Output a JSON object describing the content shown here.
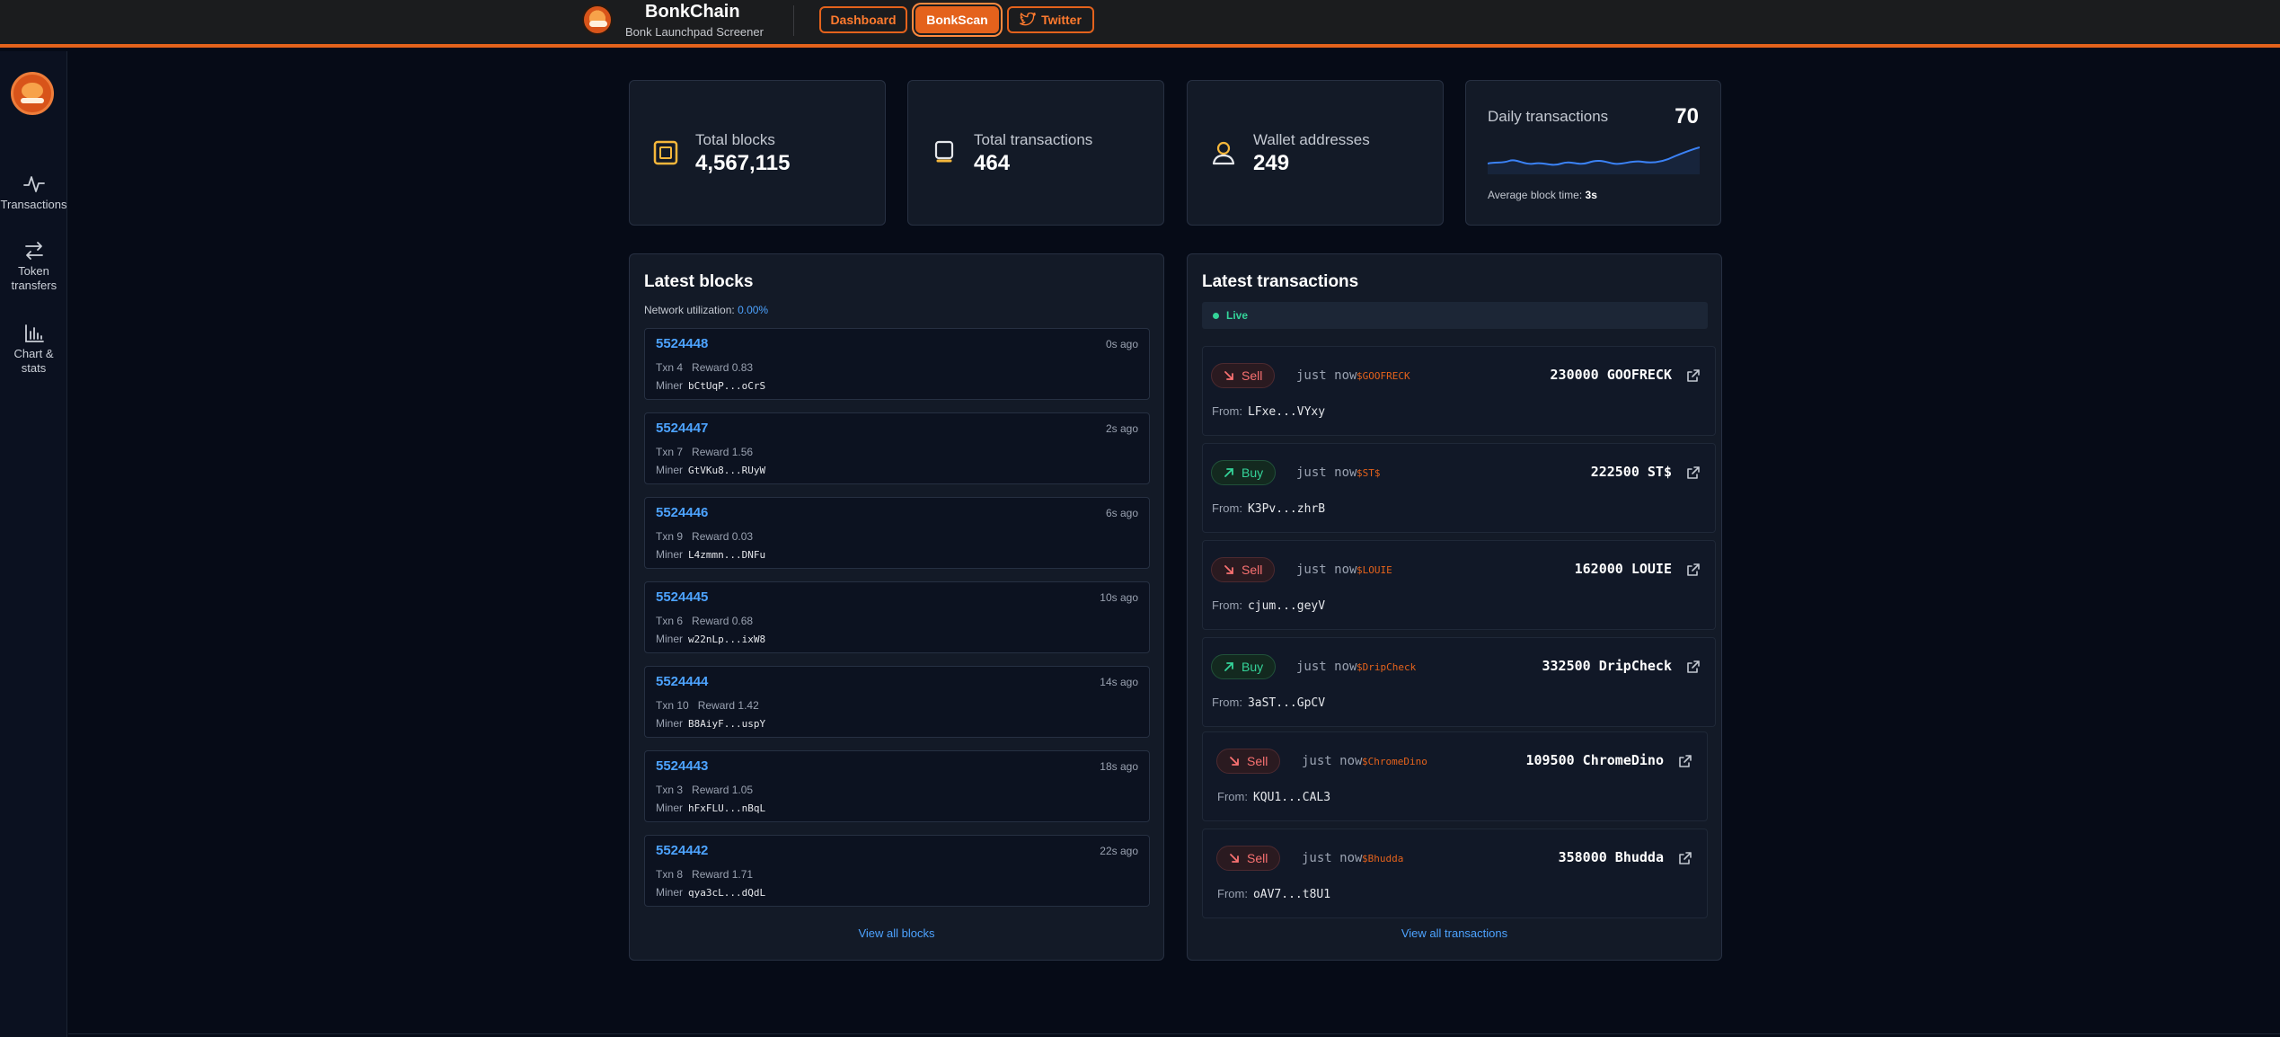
{
  "header": {
    "title": "BonkChain",
    "subtitle": "Bonk Launchpad Screener",
    "nav": {
      "dashboard": "Dashboard",
      "bonkscan": "BonkScan",
      "twitter": "Twitter"
    }
  },
  "sidebar": {
    "items": [
      {
        "label": "Transactions",
        "icon": "activity-icon"
      },
      {
        "label": "Token transfers",
        "icon": "arrows-swap-icon"
      },
      {
        "label": "Chart & stats",
        "icon": "bar-chart-icon"
      }
    ]
  },
  "stats": {
    "total_blocks": {
      "label": "Total blocks",
      "value": "4,567,115"
    },
    "total_transactions": {
      "label": "Total transactions",
      "value": "464"
    },
    "wallet_addresses": {
      "label": "Wallet addresses",
      "value": "249"
    },
    "daily": {
      "label": "Daily transactions",
      "value": "70",
      "avg_label": "Average block time:",
      "avg_value": "3s"
    }
  },
  "blocks_panel": {
    "title": "Latest blocks",
    "util_label": "Network utilization:",
    "util_value": "0.00%",
    "txn_label": "Txn",
    "reward_label": "Reward",
    "miner_label": "Miner",
    "view_all": "View all blocks",
    "blocks": [
      {
        "number": "5524448",
        "ago": "0s ago",
        "txn": "4",
        "reward": "0.83",
        "miner": "bCtUqP...oCrS"
      },
      {
        "number": "5524447",
        "ago": "2s ago",
        "txn": "7",
        "reward": "1.56",
        "miner": "GtVKu8...RUyW"
      },
      {
        "number": "5524446",
        "ago": "6s ago",
        "txn": "9",
        "reward": "0.03",
        "miner": "L4zmmn...DNFu"
      },
      {
        "number": "5524445",
        "ago": "10s ago",
        "txn": "6",
        "reward": "0.68",
        "miner": "w22nLp...ixW8"
      },
      {
        "number": "5524444",
        "ago": "14s ago",
        "txn": "10",
        "reward": "1.42",
        "miner": "B8AiyF...uspY"
      },
      {
        "number": "5524443",
        "ago": "18s ago",
        "txn": "3",
        "reward": "1.05",
        "miner": "hFxFLU...nBqL"
      },
      {
        "number": "5524442",
        "ago": "22s ago",
        "txn": "8",
        "reward": "1.71",
        "miner": "qya3cL...dQdL"
      }
    ]
  },
  "tx_panel": {
    "title": "Latest transactions",
    "live": "Live",
    "from_label": "From:",
    "view_all": "View all transactions",
    "transactions": [
      {
        "side": "Sell",
        "time": "just now",
        "token": "$GOOFRECK",
        "amount": "230000 GOOFRECK",
        "from": "LFxe...VYxy"
      },
      {
        "side": "Buy",
        "time": "just now",
        "token": "$ST$",
        "amount": "222500 ST$",
        "from": "K3Pv...zhrB"
      },
      {
        "side": "Sell",
        "time": "just now",
        "token": "$LOUIE",
        "amount": "162000 LOUIE",
        "from": "cjum...geyV"
      },
      {
        "side": "Buy",
        "time": "just now",
        "token": "$DripCheck",
        "amount": "332500 DripCheck",
        "from": "3aST...GpCV"
      },
      {
        "side": "Sell",
        "time": "just now",
        "token": "$ChromeDino",
        "amount": "109500 ChromeDino",
        "from": "KQU1...CAL3"
      },
      {
        "side": "Sell",
        "time": "just now",
        "token": "$Bhudda",
        "amount": "358000 Bhudda",
        "from": "oAV7...t8U1"
      }
    ]
  },
  "colors": {
    "accent": "#e4621c",
    "link": "#4da3ff",
    "buy": "#34d399",
    "sell": "#f87171",
    "background": "#060b17",
    "card": "#131a27"
  }
}
